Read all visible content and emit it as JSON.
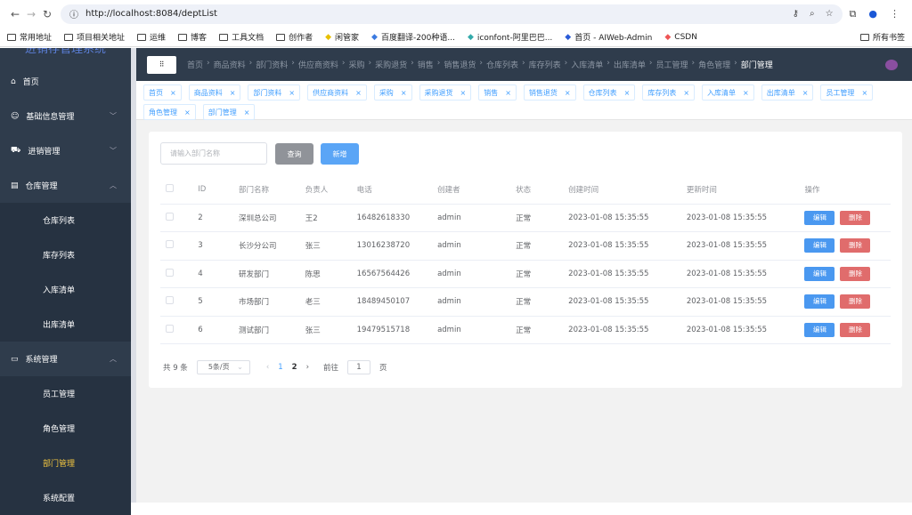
{
  "browser": {
    "url": "http://localhost:8084/deptList",
    "bookmarks": [
      "常用地址",
      "项目相关地址",
      "运维",
      "博客",
      "工具文档",
      "创作者",
      "闲管家",
      "百度翻译-200种语...",
      "iconfont-阿里巴巴...",
      "首页 - AIWeb-Admin",
      "CSDN"
    ],
    "all_bookmarks": "所有书签"
  },
  "sidebar": {
    "title": "进销存管理系统",
    "items": [
      {
        "label": "首页",
        "icon": "home-icon"
      },
      {
        "label": "基础信息管理",
        "icon": "user-icon",
        "expandable": true
      },
      {
        "label": "进销管理",
        "icon": "cart-icon",
        "expandable": true
      },
      {
        "label": "仓库管理",
        "icon": "clipboard-icon",
        "expanded": true,
        "children": [
          "仓库列表",
          "库存列表",
          "入库清单",
          "出库清单"
        ]
      },
      {
        "label": "系统管理",
        "icon": "monitor-icon",
        "expanded": true,
        "children": [
          "员工管理",
          "角色管理",
          "部门管理",
          "系统配置"
        ]
      }
    ],
    "active": "部门管理",
    "active_color": "#f3c640"
  },
  "breadcrumb": [
    "首页",
    "商品资料",
    "部门资料",
    "供应商资料",
    "采购",
    "采购退货",
    "销售",
    "销售退货",
    "仓库列表",
    "库存列表",
    "入库清单",
    "出库清单",
    "员工管理",
    "角色管理",
    "部门管理"
  ],
  "tabs": [
    "首页",
    "商品资料",
    "部门资料",
    "供应商资料",
    "采购",
    "采购退货",
    "销售",
    "销售退货",
    "仓库列表",
    "库存列表",
    "入库清单",
    "出库清单",
    "员工管理",
    "角色管理",
    "部门管理"
  ],
  "toolbar": {
    "search_placeholder": "请输入部门名称",
    "query": "查询",
    "add": "新增"
  },
  "table": {
    "headers": [
      "ID",
      "部门名称",
      "负责人",
      "电话",
      "创建者",
      "状态",
      "创建时间",
      "更新时间",
      "操作"
    ],
    "rows": [
      [
        "2",
        "深圳总公司",
        "王2",
        "16482618330",
        "admin",
        "正常",
        "2023-01-08 15:35:55",
        "2023-01-08 15:35:55"
      ],
      [
        "3",
        "长沙分公司",
        "张三",
        "13016238720",
        "admin",
        "正常",
        "2023-01-08 15:35:55",
        "2023-01-08 15:35:55"
      ],
      [
        "4",
        "研发部门",
        "陈思",
        "16567564426",
        "admin",
        "正常",
        "2023-01-08 15:35:55",
        "2023-01-08 15:35:55"
      ],
      [
        "5",
        "市场部门",
        "老三",
        "18489450107",
        "admin",
        "正常",
        "2023-01-08 15:35:55",
        "2023-01-08 15:35:55"
      ],
      [
        "6",
        "测试部门",
        "张三",
        "19479515718",
        "admin",
        "正常",
        "2023-01-08 15:35:55",
        "2023-01-08 15:35:55"
      ]
    ],
    "edit": "编辑",
    "delete": "删除"
  },
  "pagination": {
    "total": "共 9 条",
    "page_size": "5条/页",
    "pages": [
      "1",
      "2"
    ],
    "current": "1",
    "goto": "前往",
    "goto_value": "1",
    "page_unit": "页"
  },
  "colors": {
    "primary": "#409eff",
    "danger": "#e06c6c",
    "sidebar": "#2f3c4c"
  }
}
